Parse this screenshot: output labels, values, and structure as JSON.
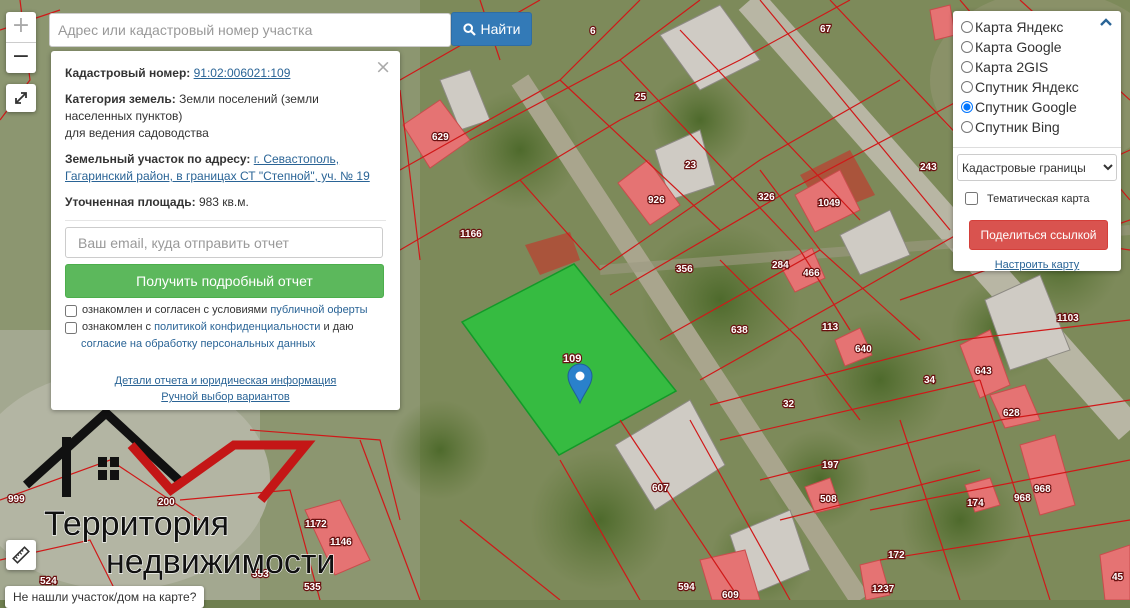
{
  "search": {
    "placeholder": "Адрес или кадастровый номер участка",
    "button_label": "Найти",
    "button_icon": "search-icon"
  },
  "zoom": {
    "in_label": "+",
    "out_label": "−"
  },
  "info_panel": {
    "cadastral_label": "Кадастровый номер:",
    "cadastral_value": "91:02:006021:109",
    "category_label": "Категория земель:",
    "category_value": "Земли поселений (земли населенных пунктов)",
    "usage_value": "для ведения садоводства",
    "address_label": "Земельный участок по адресу:",
    "address_value": "г. Севастополь, Гагаринский район, в границах СТ \"Степной\", уч. № 19",
    "area_label": "Уточненная площадь:",
    "area_value": "983 кв.м.",
    "email_placeholder": "Ваш email, куда отправить отчет",
    "report_button": "Получить подробный отчет",
    "consent1_text": "ознакомлен и согласен с условиями",
    "consent1_link": "публичной оферты",
    "consent2_text1": "ознакомлен с",
    "consent2_link1": "политикой конфиденциальности",
    "consent2_text2": "и даю",
    "consent2_link2": "согласие на обработку персональных данных",
    "details_link": "Детали отчета и юридическая информация",
    "manual_link": "Ручной выбор вариантов"
  },
  "layers": {
    "options": [
      {
        "label": "Карта Яндекс",
        "checked": false
      },
      {
        "label": "Карта Google",
        "checked": false
      },
      {
        "label": "Карта 2GIS",
        "checked": false
      },
      {
        "label": "Спутник Яндекс",
        "checked": false
      },
      {
        "label": "Спутник Google",
        "checked": true
      },
      {
        "label": "Спутник Bing",
        "checked": false
      }
    ],
    "overlay_select": "Кадастровые границы",
    "thematic_label": "Тематическая карта",
    "share_button": "Поделиться ссылкой",
    "setup_link": "Настроить карту"
  },
  "map": {
    "selected_parcel_label": "109",
    "parcel_labels": [
      "6",
      "67",
      "25",
      "629",
      "23",
      "243",
      "926",
      "326",
      "1049",
      "1166",
      "356",
      "284",
      "466",
      "638",
      "113",
      "1103",
      "640",
      "643",
      "628",
      "34",
      "32",
      "197",
      "607",
      "508",
      "174",
      "968",
      "968",
      "1172",
      "1146",
      "535",
      "524",
      "999",
      "172",
      "594",
      "609",
      "1237",
      "45",
      "553",
      "200"
    ]
  },
  "logo": {
    "line1": "Территория",
    "line2": "недвижимости"
  },
  "notfound_text": "Не нашли участок/дом на карте?",
  "colors": {
    "accent_blue": "#337ab7",
    "report_green": "#5cb85c",
    "share_red": "#d9534f",
    "parcel_fill": "#e57373",
    "selected_parcel": "#22c93a",
    "boundary": "#d01818"
  }
}
